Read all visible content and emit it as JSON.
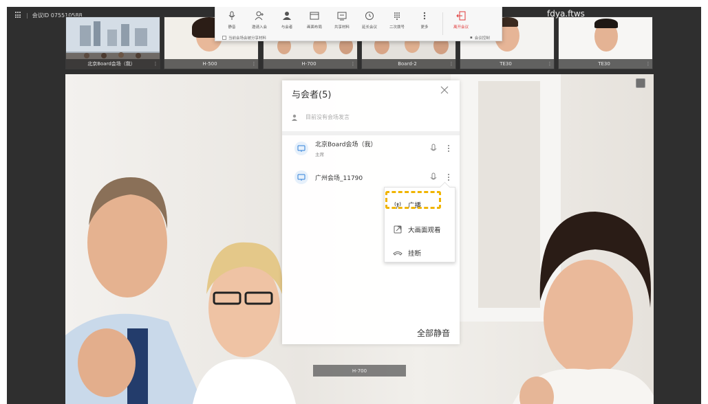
{
  "header": {
    "meeting_id_label": "会议ID 075510588",
    "site_name": "fdya.ftws"
  },
  "toolbar": {
    "items": [
      {
        "label": "静音",
        "icon": "microphone-icon"
      },
      {
        "label": "邀请入会",
        "icon": "add-user-icon"
      },
      {
        "label": "与会者",
        "icon": "participants-icon"
      },
      {
        "label": "画面布局",
        "icon": "layout-icon"
      },
      {
        "label": "共享材料",
        "icon": "share-icon"
      },
      {
        "label": "延长会议",
        "icon": "clock-icon"
      },
      {
        "label": "二次拨号",
        "icon": "dialpad-icon"
      },
      {
        "label": "更多",
        "icon": "more-icon"
      }
    ],
    "leave": {
      "label": "离开会议",
      "icon": "exit-icon",
      "color": "#e03a3a"
    },
    "sub_checkbox_label": "当前会场会被分享材料",
    "sub_control_label": "会议控制"
  },
  "thumbnails": [
    {
      "label": "北京Board会场（我）"
    },
    {
      "label": "H-500"
    },
    {
      "label": "H-700"
    },
    {
      "label": "Board-2"
    },
    {
      "label": "TE30"
    },
    {
      "label": "TE30"
    }
  ],
  "main_video": {
    "label": "H-700"
  },
  "panel": {
    "title": "与会者(5)",
    "speaker_status": "目前没有会场发言",
    "participants": [
      {
        "name": "北京Board会场（我）",
        "role": "主席"
      },
      {
        "name": "广州会场_11790",
        "role": ""
      }
    ],
    "mute_all": "全部静音"
  },
  "context_menu": {
    "items": [
      {
        "label": "广播",
        "icon": "broadcast-icon"
      },
      {
        "label": "大画面观看",
        "icon": "enlarge-view-icon"
      },
      {
        "label": "挂断",
        "icon": "hangup-icon"
      }
    ],
    "highlight_color": "#f0b400"
  },
  "colors": {
    "accent": "#1e7be0",
    "danger": "#e03a3a",
    "background": "#2f2f2f"
  }
}
